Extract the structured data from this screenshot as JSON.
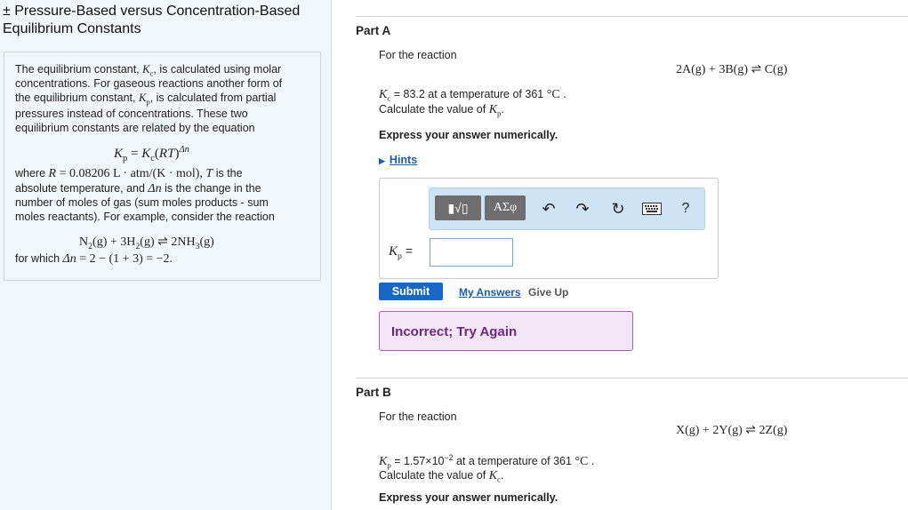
{
  "title_line1": "± Pressure-Based versus Concentration-Based",
  "title_line2": "Equilibrium Constants",
  "info": {
    "l1": "The equilibrium constant,",
    "l1b": ", is calculated using molar",
    "l2": "concentrations. For gaseous reactions another form of",
    "l3": "the equilibrium constant,",
    "l3b": ", is calculated from partial",
    "l4": "pressures instead of concentrations. These two",
    "l5": "equilibrium constants are related by the equation",
    "l6a": "where",
    "l6b": "= 0.08206 L · atm/(K · mol),",
    "l6c": "is the",
    "l7a": "absolute temperature, and",
    "l7b": "is the change in the",
    "l8": "number of moles of gas (sum moles products - sum",
    "l9": "moles reactants). For example, consider the reaction",
    "l10a": "for which",
    "l10b": "= 2 − (1 + 3) = −2."
  },
  "partA": {
    "header": "Part A",
    "for_reaction": "For the reaction",
    "kc_value": "= 83.2 at a temperature of 361",
    "unit": "°C",
    "calc": "Calculate the value of",
    "express": "Express your answer numerically.",
    "hints": "Hints",
    "kp_label": "=",
    "submit": "Submit",
    "my_answers": "My Answers",
    "give_up": "Give Up",
    "feedback": "Incorrect; Try Again"
  },
  "partB": {
    "header": "Part B",
    "for_reaction": "For the reaction",
    "kp_value": "= 1.57×10",
    "exp": "−2",
    "kp_value2": "at a temperature of 361",
    "unit": "°C",
    "calc": "Calculate the value of",
    "express": "Express your answer numerically."
  },
  "toolbar": {
    "templates": "▮√▯",
    "greek": "ΑΣφ",
    "help": "?"
  }
}
